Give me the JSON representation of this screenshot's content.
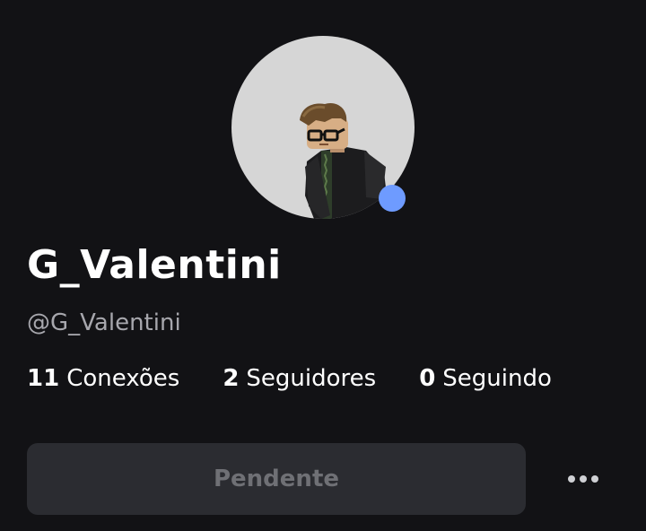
{
  "profile": {
    "display_name": "G_Valentini",
    "username": "@G_Valentini",
    "online_status_color": "#6e9bff"
  },
  "stats": [
    {
      "value": "11",
      "label": "Conexões"
    },
    {
      "value": "2",
      "label": "Seguidores"
    },
    {
      "value": "0",
      "label": "Seguindo"
    }
  ],
  "actions": {
    "pending_label": "Pendente",
    "more_icon": "more-horizontal-icon"
  },
  "colors": {
    "background": "#121215",
    "avatar_bg": "#d6d6d6",
    "button_bg": "#2b2c31",
    "button_text": "#6f7075"
  }
}
